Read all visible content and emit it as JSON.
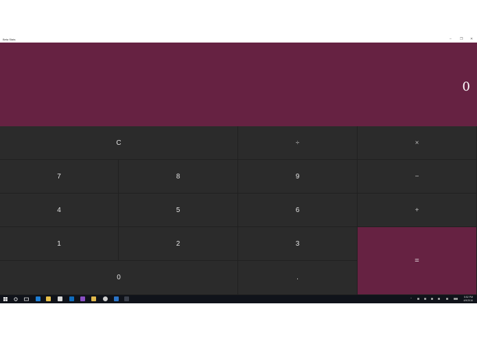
{
  "window": {
    "title": "Beta Stats",
    "controls": {
      "minimize": "–",
      "restore": "❐",
      "close": "✕"
    }
  },
  "display": {
    "value": "0"
  },
  "keys": {
    "clear": "C",
    "divide": "÷",
    "multiply": "×",
    "seven": "7",
    "eight": "8",
    "nine": "9",
    "minus": "−",
    "four": "4",
    "five": "5",
    "six": "6",
    "plus": "+",
    "one": "1",
    "two": "2",
    "three": "3",
    "equals": "=",
    "zero": "0",
    "decimal": "."
  },
  "taskbar": {
    "start_icon": "windows-logo-icon",
    "apps": [
      "search-icon",
      "task-view-icon",
      "edge-icon",
      "file-explorer-icon",
      "store-icon",
      "outlook-icon",
      "visual-studio-icon",
      "photos-icon",
      "app-icon",
      "vscode-icon",
      "active-app-icon"
    ],
    "clock_time": "5:52 PM",
    "clock_date": "4/9/2016"
  },
  "colors": {
    "accent": "#662242",
    "key_bg": "#2b2b2b",
    "taskbar": "#10131a"
  }
}
